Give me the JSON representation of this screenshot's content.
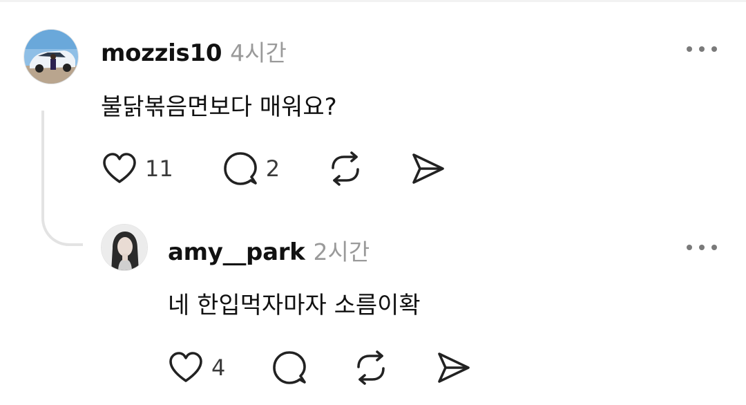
{
  "comments": [
    {
      "username": "mozzis10",
      "time": "4시간",
      "text": "불닭볶음면보다 매워요?",
      "likes": "11",
      "replies": "2",
      "avatar": "car-photo-avatar"
    },
    {
      "username": "amy__park",
      "time": "2시간",
      "text": "네 한입먹자마자 소름이확",
      "likes": "4",
      "avatar": "woman-portrait-avatar"
    }
  ],
  "icons": {
    "like": "heart-icon",
    "reply": "speech-bubble-icon",
    "repost": "repost-arrows-icon",
    "share": "paper-plane-icon",
    "more": "more-dots-icon"
  },
  "colors": {
    "text": "#111111",
    "muted": "#9a9a9a",
    "icon": "#222222",
    "thread_line": "#e3e3e3"
  }
}
